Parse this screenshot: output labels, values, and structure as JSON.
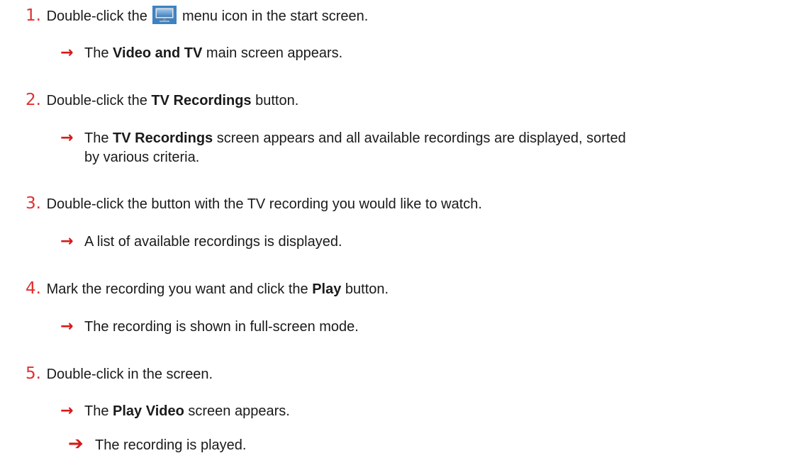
{
  "steps": [
    {
      "number": "1.",
      "text_before": "Double-click the",
      "icon": "monitor-icon",
      "text_after": "menu icon in the start screen.",
      "result": {
        "before": "The ",
        "bold": "Video and TV",
        "after": " main screen appears."
      }
    },
    {
      "number": "2.",
      "text_before": "Double-click the ",
      "bold": "TV Recordings",
      "text_after": " button.",
      "result": {
        "before": "The ",
        "bold": "TV Recordings",
        "after": " screen appears and all available recordings are displayed, sorted",
        "continuation": "by various criteria."
      }
    },
    {
      "number": "3.",
      "text": "Double-click the button with the TV recording you would like to watch.",
      "result": {
        "text": "A list of available recordings is displayed."
      }
    },
    {
      "number": "4.",
      "text_before": "Mark the recording you want and click the ",
      "bold": "Play",
      "text_after": " button.",
      "result": {
        "text": "The recording is shown in full-screen mode."
      }
    },
    {
      "number": "5.",
      "text": "Double-click in the screen.",
      "result": {
        "before": "The ",
        "bold": "Play Video",
        "after": " screen appears."
      }
    }
  ],
  "final_result": "The recording is played.",
  "colors": {
    "step_number": "#e03030",
    "arrow": "#d41a1a",
    "icon_screen": "#5b9bd5"
  }
}
